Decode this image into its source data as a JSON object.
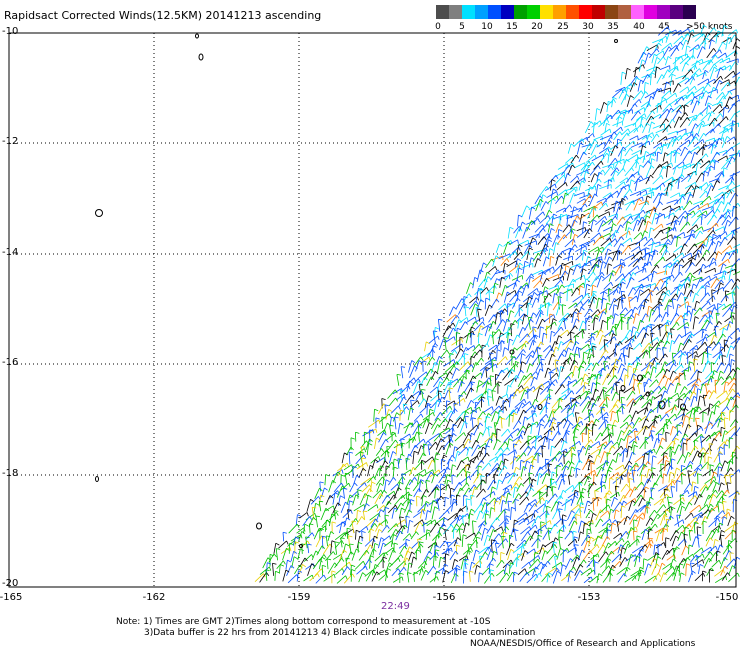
{
  "title": "Rapidsact Corrected Winds(12.5KM) 20141213 ascending",
  "legend": {
    "labels": [
      "0",
      "5",
      "10",
      "15",
      "20",
      "25",
      "30",
      "35",
      "40",
      "45",
      ">50 knots"
    ],
    "colors": [
      "#4d4d4d",
      "#7f7f7f",
      "#00e0ff",
      "#00a0ff",
      "#0050ff",
      "#0000c0",
      "#00a000",
      "#00d000",
      "#ffe000",
      "#ffa000",
      "#ff5000",
      "#ff0000",
      "#c00000",
      "#8b4513",
      "#b06040",
      "#ff60ff",
      "#e000e0",
      "#a000c0",
      "#5a0080",
      "#2a0050"
    ]
  },
  "latitude_labels": [
    "-10",
    "-12",
    "-14",
    "-16",
    "-18",
    "-20"
  ],
  "longitude_labels": [
    "-165",
    "-162",
    "-159",
    "-156",
    "-153",
    "-150"
  ],
  "time_label": "22:49",
  "notes": {
    "line1": "Note: 1) Times are GMT 2)Times along bottom correspond to measurement at -10S",
    "line2": "3)Data buffer is 22 hrs from 20141213 4) Black circles indicate possible contamination"
  },
  "credit": "NOAA/NESDIS/Office of Research and Applications",
  "map_extent": {
    "lon": [
      -165,
      -150
    ],
    "lat": [
      -20,
      -10
    ]
  },
  "wind_colors": {
    "light": "#000000",
    "cyan": "#00e0ff",
    "blue": "#0050ff",
    "green": "#00c000",
    "yellow": "#e8d000",
    "orange": "#ff8000",
    "red": "#ff2000"
  }
}
